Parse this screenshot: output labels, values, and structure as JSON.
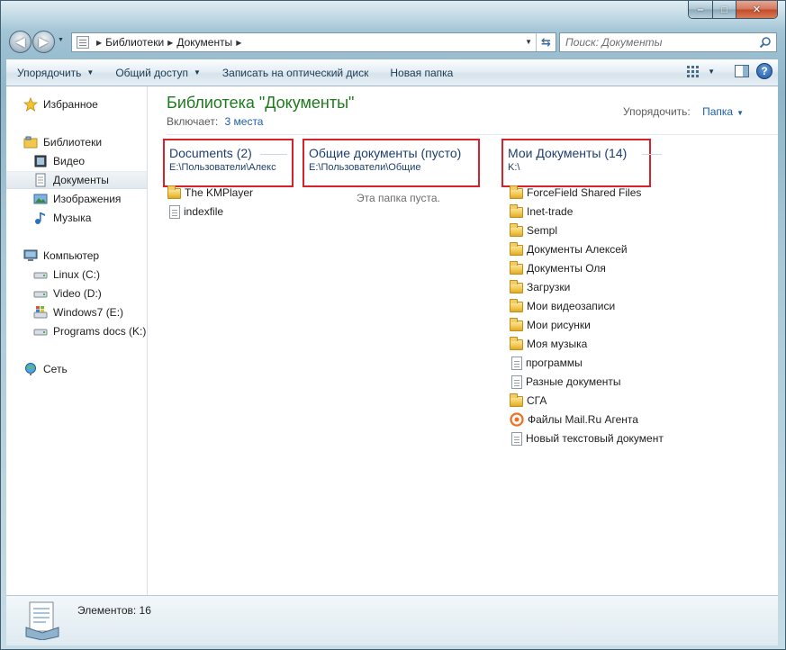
{
  "window": {
    "caption": {
      "minimize": "‒",
      "maximize": "□",
      "close": "✕"
    }
  },
  "nav": {
    "back_icon": "back-arrow-icon",
    "forward_icon": "forward-arrow-icon",
    "breadcrumb": [
      "Библиотеки",
      "Документы"
    ],
    "search_placeholder": "Поиск: Документы"
  },
  "commands": [
    {
      "label": "Упорядочить",
      "dropdown": true
    },
    {
      "label": "Общий доступ",
      "dropdown": true
    },
    {
      "label": "Записать на оптический диск",
      "dropdown": false
    },
    {
      "label": "Новая папка",
      "dropdown": false
    }
  ],
  "sidebar": {
    "favorites": "Избранное",
    "libraries": "Библиотеки",
    "library_items": [
      "Видео",
      "Документы",
      "Изображения",
      "Музыка"
    ],
    "computer": "Компьютер",
    "drives": [
      "Linux (C:)",
      "Video (D:)",
      "Windows7 (E:)",
      "Programs docs (K:)"
    ],
    "network": "Сеть"
  },
  "main": {
    "title": "Библиотека \"Документы\"",
    "includes_label": "Включает:",
    "includes_link": "3 места",
    "arrange_label": "Упорядочить:",
    "arrange_value": "Папка"
  },
  "groups": [
    {
      "name": "Documents (2)",
      "path": "E:\\Пользователи\\Алекс",
      "items": [
        {
          "name": "The KMPlayer",
          "icon": "folder"
        },
        {
          "name": "indexfile",
          "icon": "doc"
        }
      ]
    },
    {
      "name": "Общие документы (пусто)",
      "path": "E:\\Пользователи\\Общие",
      "empty_text": "Эта папка пуста.",
      "items": []
    },
    {
      "name": "Мои Документы (14)",
      "path": "K:\\",
      "items": [
        {
          "name": "ForceField Shared Files",
          "icon": "folder"
        },
        {
          "name": "Inet-trade",
          "icon": "folder"
        },
        {
          "name": "Sempl",
          "icon": "folder"
        },
        {
          "name": "Документы Алексей",
          "icon": "folder"
        },
        {
          "name": "Документы Оля",
          "icon": "folder"
        },
        {
          "name": "Загрузки",
          "icon": "folder"
        },
        {
          "name": "Мои видеозаписи",
          "icon": "folder"
        },
        {
          "name": "Мои рисунки",
          "icon": "folder"
        },
        {
          "name": "Моя музыка",
          "icon": "folder"
        },
        {
          "name": "программы",
          "icon": "doc"
        },
        {
          "name": "Разные документы",
          "icon": "doc"
        },
        {
          "name": "СГА",
          "icon": "folder"
        },
        {
          "name": "Файлы Mail.Ru Агента",
          "icon": "mailru"
        },
        {
          "name": "Новый текстовый документ",
          "icon": "doc"
        }
      ]
    }
  ],
  "status": {
    "count": "Элементов: 16"
  }
}
